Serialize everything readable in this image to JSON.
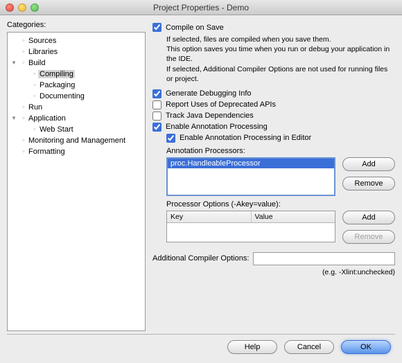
{
  "window_title": "Project Properties - Demo",
  "categories_label": "Categories:",
  "tree": {
    "sources": "Sources",
    "libraries": "Libraries",
    "build": "Build",
    "compiling": "Compiling",
    "packaging": "Packaging",
    "documenting": "Documenting",
    "run": "Run",
    "application": "Application",
    "web_start": "Web Start",
    "monitoring": "Monitoring and Management",
    "formatting": "Formatting"
  },
  "checks": {
    "compile_on_save": "Compile on Save",
    "generate_debug": "Generate Debugging Info",
    "deprecated": "Report Uses of Deprecated APIs",
    "track_deps": "Track Java Dependencies",
    "anno_proc": "Enable Annotation Processing",
    "anno_editor": "Enable Annotation Processing in Editor"
  },
  "desc": {
    "line1": "If selected, files are compiled when you save them.",
    "line2": "This option saves you time when you run or debug your application in the IDE.",
    "line3": "If selected, Additional Compiler Options are not used for running files or project."
  },
  "labels": {
    "anno_processors": "Annotation Processors:",
    "proc_options": "Processor Options (-Akey=value):",
    "key": "Key",
    "value": "Value",
    "addl": "Additional Compiler Options:",
    "example": "(e.g. -Xlint:unchecked)"
  },
  "list": {
    "item0": "proc.HandleableProcessor"
  },
  "buttons": {
    "add": "Add",
    "remove": "Remove",
    "help": "Help",
    "cancel": "Cancel",
    "ok": "OK"
  },
  "inputs": {
    "addl_value": ""
  }
}
